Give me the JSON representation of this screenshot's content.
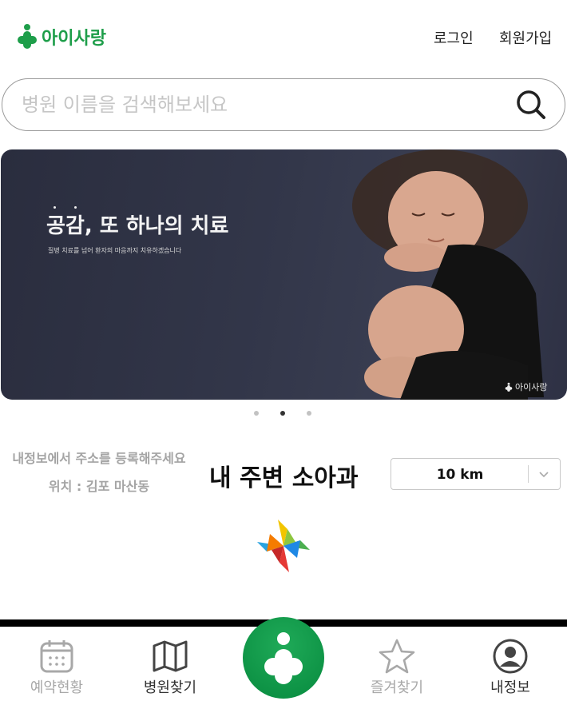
{
  "header": {
    "logo_text": "아이사랑",
    "login": "로그인",
    "signup": "회원가입"
  },
  "search": {
    "placeholder": "병원 이름을 검색해보세요"
  },
  "banner": {
    "title": "공감, 또 하나의 치료",
    "subtitle": "질병 치료를 넘어 환자의 마음까지 치유하겠습니다",
    "brand": "아이사랑",
    "slide_count": 3,
    "active_slide": 2
  },
  "nearby": {
    "address_notice": "내정보에서 주소를 등록해주세요",
    "location_line": "위치 : 김포 마산동",
    "title": "내 주변 소아과",
    "distance": "10 km"
  },
  "bottom_nav": {
    "items": [
      {
        "label": "예약현황",
        "icon": "calendar-icon"
      },
      {
        "label": "병원찾기",
        "icon": "map-icon"
      },
      {
        "label": "",
        "icon": "logo-plus-icon"
      },
      {
        "label": "즐겨찾기",
        "icon": "star-icon"
      },
      {
        "label": "내정보",
        "icon": "user-icon"
      }
    ]
  },
  "colors": {
    "brand_green": "#1e9e4a",
    "banner_bg": "#2f3345",
    "inactive": "#a8a8a8"
  }
}
